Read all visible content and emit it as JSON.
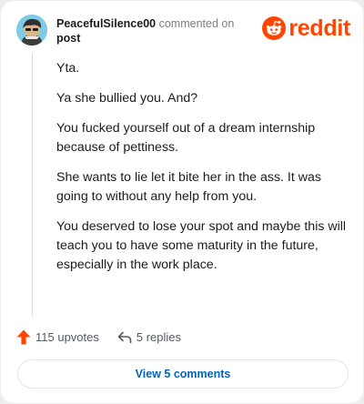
{
  "header": {
    "username": "PeacefulSilence00",
    "action_text": "commented on",
    "target_text": "post"
  },
  "logo": {
    "wordmark": "reddit",
    "icon": "reddit-alien-icon",
    "color": "#ff4500"
  },
  "comment": {
    "paragraphs": [
      "Yta.",
      "Ya she bullied you. And?",
      "You fucked yourself out of a dream internship because of pettiness.",
      "She wants to lie let it bite her in the ass. It was going to without any help from you.",
      "You deserved to lose your spot and maybe this will teach you to have some maturity in the future, especially in the work place."
    ]
  },
  "actions": {
    "upvotes_label": "115 upvotes",
    "upvote_icon": "upvote-arrow-icon",
    "replies_label": "5 replies",
    "reply_icon": "reply-arrow-icon"
  },
  "view_button": {
    "label": "View 5 comments",
    "color": "#0063c5"
  }
}
